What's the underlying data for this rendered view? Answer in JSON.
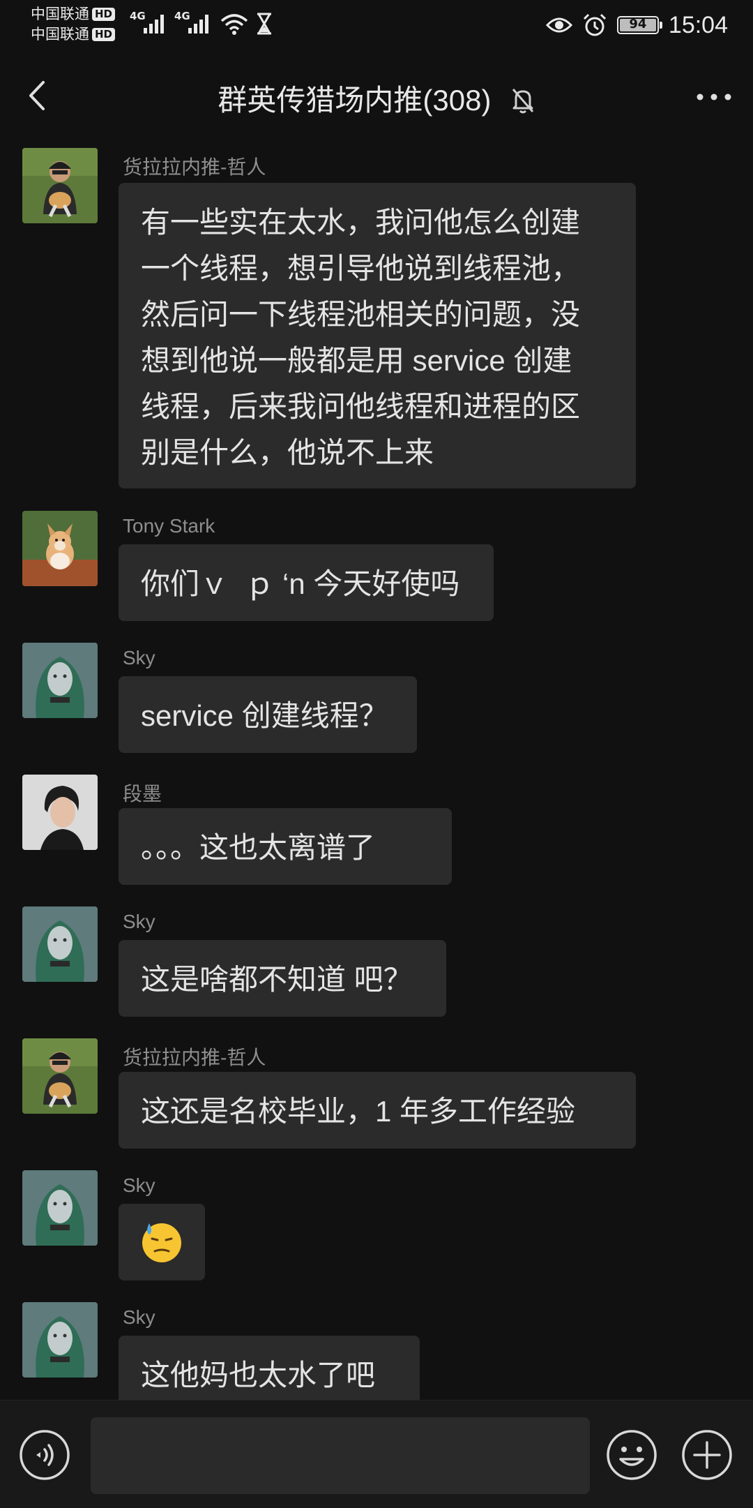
{
  "status_bar": {
    "carrier_1": "中国联通",
    "carrier_2": "中国联通",
    "hd_badge": "HD",
    "network_1": "4G",
    "network_2": "4G",
    "battery_level": "94",
    "time": "15:04"
  },
  "header": {
    "title": "群英传猎场内推(308)",
    "back_icon": "chevron-left-icon",
    "mute_icon": "bell-off-icon",
    "more_icon": "more-dots-icon"
  },
  "messages": [
    {
      "sender": "货拉拉内推-哲人",
      "avatar": "avatar-person-grass",
      "lines": [
        "有一些实在太水，我问他怎么创建",
        "一个线程，想引导他说到线程池，",
        "然后问一下线程池相关的问题，没",
        "想到他说一般都是用 service 创建",
        "线程，后来我问他线程和进程的区",
        "别是什么，他说不上来"
      ]
    },
    {
      "sender": "Tony Stark",
      "avatar": "avatar-corgi",
      "lines": [
        "你们ｖ  ｐ ‘n 今天好使吗"
      ]
    },
    {
      "sender": "Sky",
      "avatar": "avatar-green-hair",
      "lines": [
        "service 创建线程？"
      ]
    },
    {
      "sender": "段墨",
      "avatar": "avatar-portrait-gray",
      "lines": [
        "。。。这也太离谱了"
      ]
    },
    {
      "sender": "Sky",
      "avatar": "avatar-green-hair",
      "lines": [
        "这是啥都不知道 吧？"
      ]
    },
    {
      "sender": "货拉拉内推-哲人",
      "avatar": "avatar-person-grass",
      "lines": [
        "这还是名校毕业，1 年多工作经验"
      ]
    },
    {
      "sender": "Sky",
      "avatar": "avatar-green-hair",
      "lines": [],
      "emoji": "sweat-emoji"
    },
    {
      "sender": "Sky",
      "avatar": "avatar-green-hair",
      "lines": [
        "这他妈也太水了吧"
      ]
    }
  ],
  "input_bar": {
    "voice_icon": "voice-icon",
    "text_value": "",
    "emoji_icon": "smile-icon",
    "plus_icon": "plus-icon"
  },
  "colors": {
    "background": "#111111",
    "bubble": "#2b2b2b",
    "sender_text": "#8e8e8e",
    "message_text": "#e4e4e4"
  }
}
